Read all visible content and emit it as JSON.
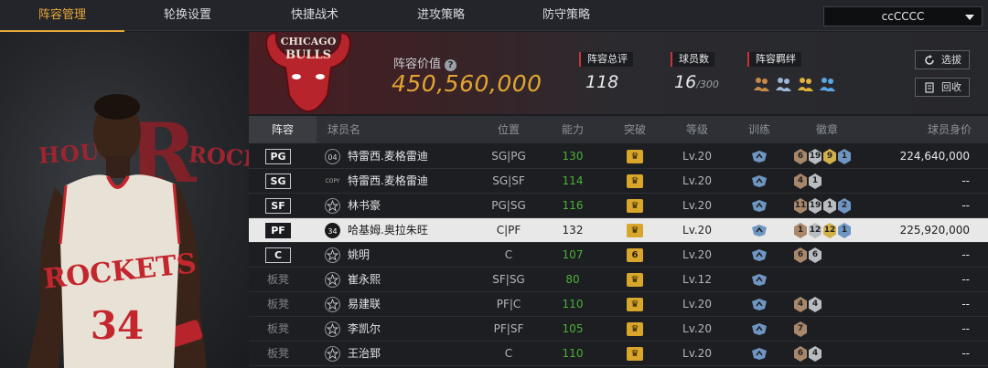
{
  "tabs": [
    {
      "label": "阵容管理",
      "active": true
    },
    {
      "label": "轮换设置",
      "active": false
    },
    {
      "label": "快捷战术",
      "active": false
    },
    {
      "label": "进攻策略",
      "active": false
    },
    {
      "label": "防守策略",
      "active": false
    }
  ],
  "dropdown": {
    "value": "ccCCCC"
  },
  "portrait": {
    "team_text_left": "HOUS",
    "team_text_right": "ROCK",
    "team_logo_letter": "R"
  },
  "team_logo": {
    "line1": "CHICAGO",
    "line2": "BULLS"
  },
  "header": {
    "value_label": "阵容价值",
    "value_help": "?",
    "value": "450,560,000",
    "overall_label": "阵容总评",
    "overall_value": "118",
    "players_label": "球员数",
    "players_value": "16",
    "players_max": "/300",
    "bond_label": "阵容羁绊",
    "btn_select": "选拔",
    "btn_recycle": "回收"
  },
  "columns": [
    "阵容",
    "球员名",
    "位置",
    "能力",
    "突破",
    "等级",
    "训练",
    "徽章",
    "球员身价"
  ],
  "rows": [
    {
      "slot": "PG",
      "bench": false,
      "badge_num": "04",
      "name": "特雷西.麦格雷迪",
      "position": "SG|PG",
      "ability": "130",
      "breakthrough": "",
      "level": "Lv.20",
      "badges": [
        {
          "v": "6",
          "c": "bronze"
        },
        {
          "v": "19",
          "c": "silver"
        },
        {
          "v": "9",
          "c": "gold"
        },
        {
          "v": "1",
          "c": "blue"
        }
      ],
      "value": "224,640,000",
      "selected": false
    },
    {
      "slot": "SG",
      "bench": false,
      "badge_num": "COPY",
      "name": "特雷西.麦格雷迪",
      "position": "SG|SF",
      "ability": "114",
      "breakthrough": "",
      "level": "Lv.20",
      "badges": [
        {
          "v": "4",
          "c": "bronze"
        },
        {
          "v": "1",
          "c": "silver"
        }
      ],
      "value": "--",
      "selected": false
    },
    {
      "slot": "SF",
      "bench": false,
      "badge_num": "",
      "name": "林书豪",
      "position": "PG|SG",
      "ability": "116",
      "breakthrough": "",
      "level": "Lv.20",
      "badges": [
        {
          "v": "11",
          "c": "bronze"
        },
        {
          "v": "19",
          "c": "silver"
        },
        {
          "v": "1",
          "c": "silver"
        },
        {
          "v": "2",
          "c": "blue"
        }
      ],
      "value": "--",
      "selected": false
    },
    {
      "slot": "PF",
      "bench": false,
      "badge_num": "34",
      "name": "哈基姆.奥拉朱旺",
      "position": "C|PF",
      "ability": "132",
      "breakthrough": "",
      "level": "Lv.20",
      "badges": [
        {
          "v": "1",
          "c": "bronze"
        },
        {
          "v": "12",
          "c": "silver"
        },
        {
          "v": "12",
          "c": "gold"
        },
        {
          "v": "1",
          "c": "blue"
        }
      ],
      "value": "225,920,000",
      "selected": true
    },
    {
      "slot": "C",
      "bench": false,
      "badge_num": "",
      "name": "姚明",
      "position": "C",
      "ability": "107",
      "breakthrough": "6",
      "level": "Lv.20",
      "badges": [
        {
          "v": "6",
          "c": "bronze"
        },
        {
          "v": "6",
          "c": "silver"
        }
      ],
      "value": "--",
      "selected": false
    },
    {
      "slot": "板凳",
      "bench": true,
      "badge_num": "",
      "name": "崔永熙",
      "position": "SF|SG",
      "ability": "80",
      "breakthrough": "",
      "level": "Lv.12",
      "badges": [],
      "value": "--",
      "selected": false
    },
    {
      "slot": "板凳",
      "bench": true,
      "badge_num": "",
      "name": "易建联",
      "position": "PF|C",
      "ability": "110",
      "breakthrough": "",
      "level": "Lv.20",
      "badges": [
        {
          "v": "4",
          "c": "bronze"
        },
        {
          "v": "4",
          "c": "silver"
        }
      ],
      "value": "--",
      "selected": false
    },
    {
      "slot": "板凳",
      "bench": true,
      "badge_num": "",
      "name": "李凯尔",
      "position": "PF|SF",
      "ability": "105",
      "breakthrough": "",
      "level": "Lv.20",
      "badges": [
        {
          "v": "7",
          "c": "bronze"
        }
      ],
      "value": "--",
      "selected": false
    },
    {
      "slot": "板凳",
      "bench": true,
      "badge_num": "",
      "name": "王治郅",
      "position": "C",
      "ability": "110",
      "breakthrough": "",
      "level": "Lv.20",
      "badges": [
        {
          "v": "6",
          "c": "bronze"
        },
        {
          "v": "4",
          "c": "silver"
        }
      ],
      "value": "--",
      "selected": false
    }
  ]
}
